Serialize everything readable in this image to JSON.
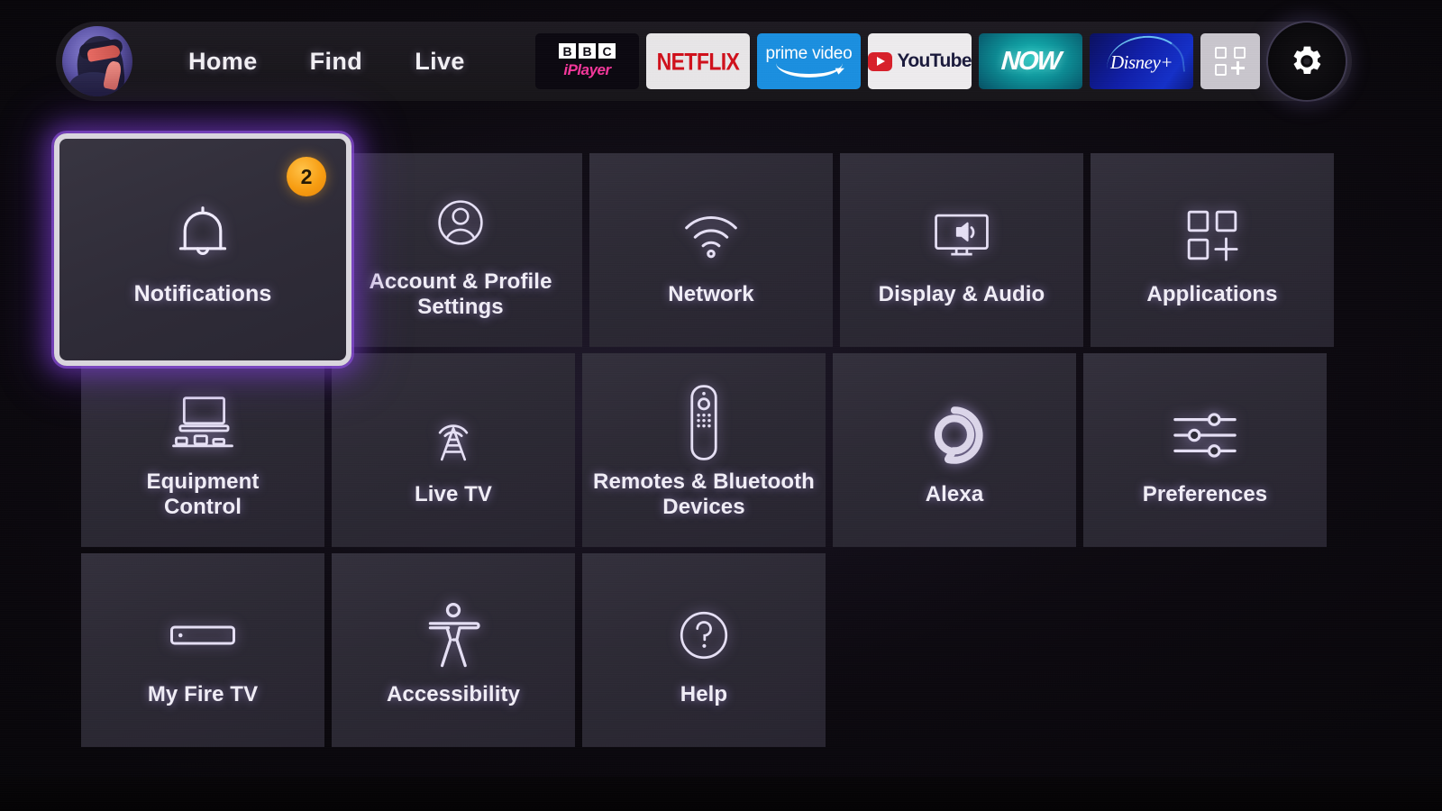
{
  "nav": {
    "avatar_name": "profile-avatar",
    "links": [
      {
        "label": "Home"
      },
      {
        "label": "Find"
      },
      {
        "label": "Live"
      }
    ],
    "apps": [
      {
        "id": "bbc-iplayer",
        "name": "BBC iPlayer",
        "bbc_letters": [
          "B",
          "B",
          "C"
        ],
        "wordmark": "iPlayer"
      },
      {
        "id": "netflix",
        "name": "Netflix",
        "wordmark": "NETFLIX"
      },
      {
        "id": "prime-video",
        "name": "Prime Video",
        "wordmark": "prime video"
      },
      {
        "id": "youtube",
        "name": "YouTube",
        "wordmark": "YouTube"
      },
      {
        "id": "now",
        "name": "NOW",
        "wordmark": "NOW"
      },
      {
        "id": "disney-plus",
        "name": "Disney+",
        "wordmark": "Disney+"
      }
    ],
    "apps_button_label": "Apps",
    "settings_button_label": "Settings"
  },
  "grid": {
    "rows": [
      [
        {
          "label": "Notifications",
          "icon": "bell-icon",
          "selected": true,
          "badge": "2"
        },
        {
          "label": "Account & Profile\nSettings",
          "icon": "person-circle-icon",
          "selected": false
        },
        {
          "label": "Network",
          "icon": "wifi-icon",
          "selected": false
        },
        {
          "label": "Display & Audio",
          "icon": "tv-speaker-icon",
          "selected": false
        },
        {
          "label": "Applications",
          "icon": "app-grid-plus-icon",
          "selected": false
        }
      ],
      [
        {
          "label": "Equipment\nControl",
          "icon": "monitor-devices-icon",
          "selected": false
        },
        {
          "label": "Live TV",
          "icon": "broadcast-tower-icon",
          "selected": false
        },
        {
          "label": "Remotes & Bluetooth\nDevices",
          "icon": "remote-control-icon",
          "selected": false
        },
        {
          "label": "Alexa",
          "icon": "alexa-ring-icon",
          "selected": false
        },
        {
          "label": "Preferences",
          "icon": "sliders-icon",
          "selected": false
        }
      ],
      [
        {
          "label": "My Fire TV",
          "icon": "fire-tv-stick-icon",
          "selected": false
        },
        {
          "label": "Accessibility",
          "icon": "accessibility-person-icon",
          "selected": false
        },
        {
          "label": "Help",
          "icon": "question-circle-icon",
          "selected": false
        }
      ]
    ]
  },
  "bezel": {
    "brand": ""
  },
  "colors": {
    "badge_orange": "#f79d12",
    "selection_glow_purple": "#8040d7",
    "selection_border": "#d9d6dd",
    "tile_background": "#2f2c38",
    "screen_background": "#0b080e",
    "nav_background": "#1d1a21",
    "text_primary": "#f1eef7",
    "netflix_red": "#d0101b",
    "prime_blue": "#1a8fe0",
    "youtube_red": "#d8202a",
    "iplayer_pink": "#f5379b",
    "now_teal": "#0c8e96",
    "disney_blue": "#101ea8"
  }
}
